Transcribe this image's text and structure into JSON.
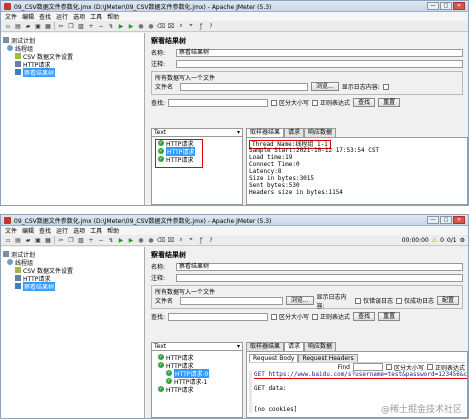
{
  "window1": {
    "title": "09_CSV数据文件参数化.jmx (D:\\JMeter\\09_CSV数据文件参数化.jmx) - Apache JMeter (5.3)",
    "menu": [
      "文件",
      "编辑",
      "查找",
      "运行",
      "选项",
      "工具",
      "帮助"
    ],
    "tree": {
      "plan": "测试计划",
      "group": "线程组",
      "csv": "CSV 数据文件设置",
      "http": "HTTP请求",
      "listener": "察看结果树"
    },
    "panel_title": "察看结果树",
    "name_label": "名称:",
    "name_value": "察看结果树",
    "comment_label": "注释:",
    "file_section": "所有数据写入一个文件",
    "file_label": "文件名",
    "browse_button": "浏览...",
    "log_label": "显示日志内容:",
    "search_label": "查找:",
    "case_label": "区分大小写",
    "regex_label": "正则表达式",
    "find_button": "查找",
    "reset_button": "重置",
    "renderer": "Text",
    "samplers": [
      "HTTP请求",
      "HTTP请求",
      "HTTP请求"
    ],
    "tabs": [
      "取样器结果",
      "请求",
      "响应数据"
    ],
    "result_lines": [
      "Thread Name:线程组 1-1",
      "Sample Start:2021-10-12 17:53:54 CST",
      "Load time:19",
      "Connect Time:0",
      "Latency:8",
      "Size in bytes:3015",
      "Sent bytes:530",
      "Headers size in bytes:1154"
    ]
  },
  "window2": {
    "title": "09_CSV数据文件参数化.jmx (D:\\JMeter\\09_CSV数据文件参数化.jmx) - Apache JMeter (5.3)",
    "menu": [
      "文件",
      "编辑",
      "查找",
      "运行",
      "选项",
      "工具",
      "帮助"
    ],
    "timer": "00:00:00",
    "warn_count": "0",
    "thread_count": "0/1",
    "tree": {
      "plan": "测试计划",
      "group": "线程组",
      "csv": "CSV 数据文件设置",
      "http": "HTTP请求",
      "listener": "察看结果树"
    },
    "panel_title": "察看结果树",
    "name_label": "名称:",
    "name_value": "察看结果树",
    "comment_label": "注释:",
    "file_section": "所有数据写入一个文件",
    "file_label": "文件名",
    "browse_button": "浏览...",
    "log_label": "显示日志内容:",
    "only_errors": "仅错误日志",
    "only_success": "仅成功日志",
    "configure_button": "配置",
    "search_label": "查找:",
    "case_label": "区分大小写",
    "regex_label": "正则表达式",
    "find_button": "查找",
    "reset_button": "重置",
    "renderer": "Text",
    "samplers": [
      "HTTP请求",
      "HTTP请求",
      "HTTP请求-0",
      "HTTP请求-1",
      "HTTP请求"
    ],
    "tabs": [
      "取样器结果",
      "请求",
      "响应数据"
    ],
    "subtabs": [
      "Request Body",
      "Request Headers"
    ],
    "find_label": "Find",
    "case_small": "区分大小写",
    "regex_small": "正则表达式",
    "request_lines": [
      "GET https://www.baidu.com/s?username=test&password=123456&code=222",
      "",
      "GET data:",
      "",
      "",
      "[no cookies]"
    ]
  },
  "watermark": "@稀土掘金技术社区"
}
